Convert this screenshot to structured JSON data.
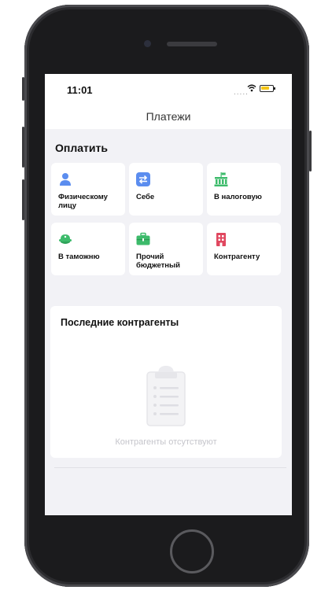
{
  "status_bar": {
    "time": "11:01",
    "signal": "....."
  },
  "nav": {
    "title": "Платежи"
  },
  "pay_section": {
    "title": "Оплатить",
    "tiles": [
      {
        "label": "Физическому лицу",
        "icon": "person-icon",
        "color": "#5b8def"
      },
      {
        "label": "Себе",
        "icon": "transfer-arrows-icon",
        "color": "#5b8def"
      },
      {
        "label": "В налоговую",
        "icon": "tax-building-icon",
        "color": "#3dbb6b"
      },
      {
        "label": "В таможню",
        "icon": "customs-cap-icon",
        "color": "#3dbb6b"
      },
      {
        "label": "Прочий бюджетный",
        "icon": "briefcase-icon",
        "color": "#3dbb6b"
      },
      {
        "label": "Контрагенту",
        "icon": "office-building-icon",
        "color": "#e0475f"
      }
    ]
  },
  "recent_section": {
    "title": "Последние контрагенты",
    "empty_text": "Контрагенты отсутствуют",
    "empty_icon": "clipboard-icon"
  }
}
